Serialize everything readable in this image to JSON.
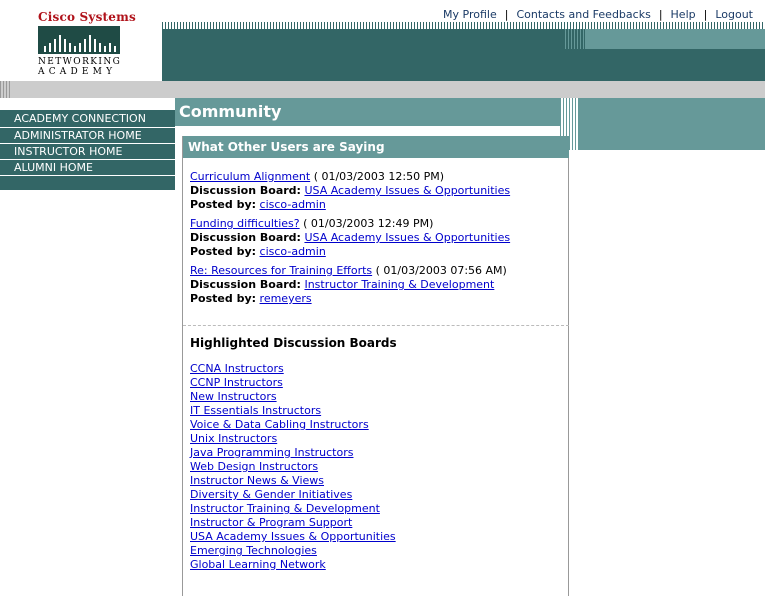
{
  "brand": {
    "company": "Cisco Systems",
    "academy_line1": "Networking",
    "academy_line2": "Academy"
  },
  "top_links": [
    "My Profile",
    "Contacts and Feedbacks",
    "Help",
    "Logout"
  ],
  "nav": {
    "items": [
      "ACADEMY CONNECTION",
      "ADMINISTRATOR HOME",
      "INSTRUCTOR HOME",
      "ALUMNI HOME"
    ]
  },
  "page_title": "Community",
  "panel": {
    "title": "What Other Users are Saying",
    "discussion_board_label": "Discussion Board:",
    "posted_by_label": "Posted by:",
    "posts": [
      {
        "subject": "Curriculum Alignment",
        "time": "( 01/03/2003 12:50 PM)",
        "board": "USA Academy Issues & Opportunities",
        "author": "cisco-admin"
      },
      {
        "subject": "Funding difficulties?",
        "time": "( 01/03/2003 12:49 PM)",
        "board": "USA Academy Issues & Opportunities",
        "author": "cisco-admin"
      },
      {
        "subject": "Re: Resources for Training Efforts",
        "time": "( 01/03/2003 07:56 AM)",
        "board": "Instructor Training & Development",
        "author": "remeyers"
      }
    ],
    "highlighted_title": "Highlighted Discussion Boards",
    "boards": [
      "CCNA Instructors",
      "CCNP Instructors",
      "New Instructors",
      "IT Essentials Instructors",
      "Voice & Data Cabling Instructors",
      "Unix Instructors",
      "Java Programming Instructors",
      "Web Design Instructors",
      "Instructor News & Views",
      "Diversity & Gender Initiatives",
      "Instructor Training & Development",
      "Instructor & Program Support",
      "USA Academy Issues & Opportunities",
      "Emerging Technologies",
      "Global Learning Network"
    ]
  },
  "colors": {
    "dark_teal": "#336666",
    "mid_teal": "#669999",
    "link": "#0000cc",
    "brand_red": "#b0121a"
  }
}
